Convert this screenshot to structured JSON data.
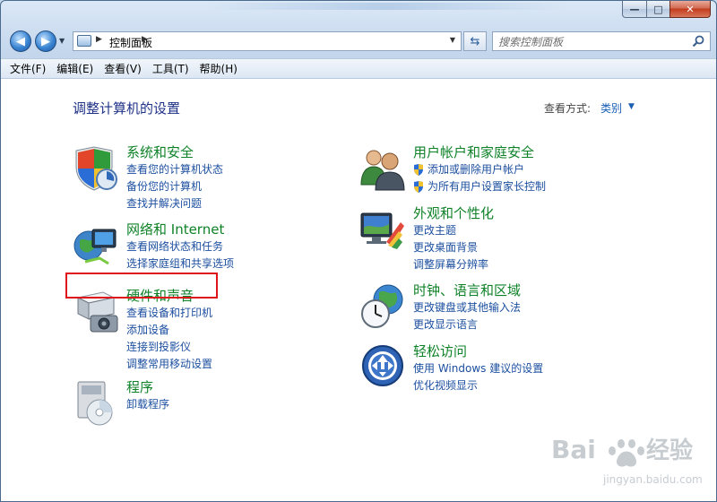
{
  "address": {
    "path": "控制面板",
    "search_placeholder": "搜索控制面板"
  },
  "window_controls": {
    "minimize": "—",
    "maximize": "□",
    "close": "✕"
  },
  "menu": [
    "文件(F)",
    "编辑(E)",
    "查看(V)",
    "工具(T)",
    "帮助(H)"
  ],
  "page": {
    "title": "调整计算机的设置",
    "view_label": "查看方式:",
    "view_value": "类别"
  },
  "categories_left": [
    {
      "title": "系统和安全",
      "icon": "shield-icon",
      "links": [
        "查看您的计算机状态",
        "备份您的计算机",
        "查找并解决问题"
      ]
    },
    {
      "title": "网络和 Internet",
      "icon": "globe-network-icon",
      "links": [
        "查看网络状态和任务",
        "选择家庭组和共享选项"
      ]
    },
    {
      "title": "硬件和声音",
      "icon": "printer-speaker-icon",
      "links": [
        "查看设备和打印机",
        "添加设备",
        "连接到投影仪",
        "调整常用移动设置"
      ]
    },
    {
      "title": "程序",
      "icon": "programs-disc-icon",
      "links": [
        "卸载程序"
      ]
    }
  ],
  "categories_right": [
    {
      "title": "用户帐户和家庭安全",
      "icon": "users-icon",
      "links": [
        "添加或删除用户帐户",
        "为所有用户设置家长控制"
      ]
    },
    {
      "title": "外观和个性化",
      "icon": "monitor-palette-icon",
      "links": [
        "更改主题",
        "更改桌面背景",
        "调整屏幕分辨率"
      ]
    },
    {
      "title": "时钟、语言和区域",
      "icon": "clock-globe-icon",
      "links": [
        "更改键盘或其他输入法",
        "更改显示语言"
      ]
    },
    {
      "title": "轻松访问",
      "icon": "ease-of-access-icon",
      "links": [
        "使用 Windows 建议的设置",
        "优化视频显示"
      ]
    }
  ],
  "watermark": {
    "brand_left": "Bai",
    "brand_right": "经验",
    "url": "jingyan.baidu.com"
  },
  "colors": {
    "category_title": "#0f8228",
    "link": "#1c4fa0",
    "page_title": "#1e3287",
    "highlight": "#e0151b"
  }
}
